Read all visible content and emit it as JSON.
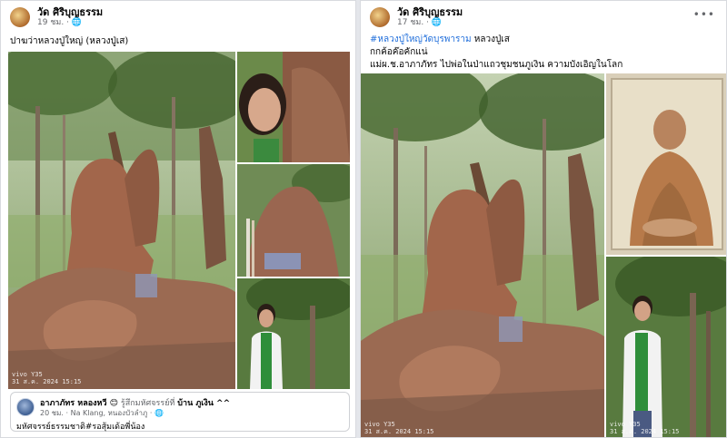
{
  "left_post": {
    "page_name": "วัด ศิริบุญธรรม",
    "time": "19 ชม. · 🌐",
    "caption": "ปาฆว่าหลวงปู่ใหญ่ (หลวงปู่เส)",
    "more": "•••",
    "watermark_line1": "vivo Y35",
    "watermark_line2": "31 ส.ค. 2024 15:15",
    "comment": {
      "author": "อาภาภัทร หลองหวี 😊",
      "feeling": "รู้สึกมหัศจรรย์ที่",
      "place": "บ้าน ภูเงิน ^^",
      "meta": "20 ชม. · Na Klang, หนองบัวลำภู · 🌐",
      "text": "มหัศจรรย์ธรรมชาติ#รอสุ้มเด้อพี่น้อง"
    }
  },
  "right_post": {
    "page_name": "วัด ศิริบุญธรรม",
    "time": "17 ชม. · 🌐",
    "hashtag": "#หลวงปู่ใหญ่วัดบุรพาราม",
    "caption_tail": " หลวงปู่เส",
    "caption_line2": "กกค้อค๊อคักแน่",
    "caption_line3": "แม่ผ.ช.อาภาภัทร ไปพ่อในป่าแถวชุมชนภูเงิน  ความบังเอิญในโลก",
    "more": "•••",
    "watermark_line1": "vivo Y35",
    "watermark_line2": "31 ส.ค. 2024 15:15"
  },
  "colors": {
    "link": "#216fdb",
    "muted": "#65676b",
    "text": "#050505"
  }
}
